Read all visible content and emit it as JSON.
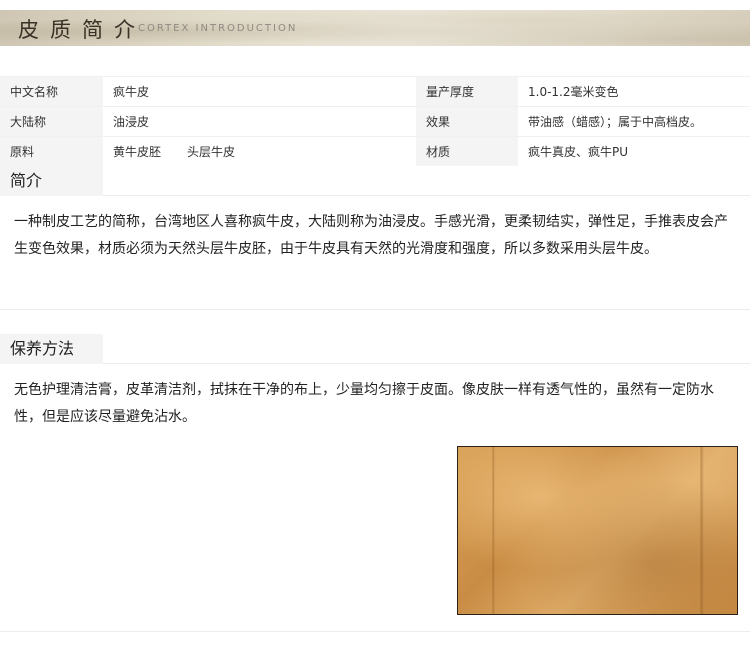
{
  "banner": {
    "title": "皮质简介",
    "subtitle": "CORTEX INTRODUCTION"
  },
  "spec": {
    "rows": [
      {
        "label1": "中文名称",
        "value1": "疯牛皮",
        "label2": "量产厚度",
        "value2": "1.0-1.2毫米变色"
      },
      {
        "label1": "大陆称",
        "value1": "油浸皮",
        "label2": "效果",
        "value2": "带油感（蜡感）；属于中高档皮。"
      },
      {
        "label1": "原料",
        "value1a": "黄牛皮胚",
        "value1b": "头层牛皮",
        "label2": "材质",
        "value2": "疯牛真皮、疯牛PU"
      }
    ]
  },
  "intro": {
    "heading": "简介",
    "text": "一种制皮工艺的简称，台湾地区人喜称疯牛皮，大陆则称为油浸皮。手感光滑，更柔韧结实，弹性足，手推表皮会产生变色效果，材质必须为天然头层牛皮胚，由于牛皮具有天然的光滑度和强度，所以多数采用头层牛皮。"
  },
  "care": {
    "heading": "保养方法",
    "text": "无色护理清洁膏，皮革清洁剂，拭抹在干净的布上，少量均匀擦于皮面。像皮肤一样有透气性的，虽然有一定防水性，但是应该尽量避免沾水。"
  },
  "colors": {
    "label_bg": "#f4f4f4",
    "leather": "#d49a52"
  }
}
